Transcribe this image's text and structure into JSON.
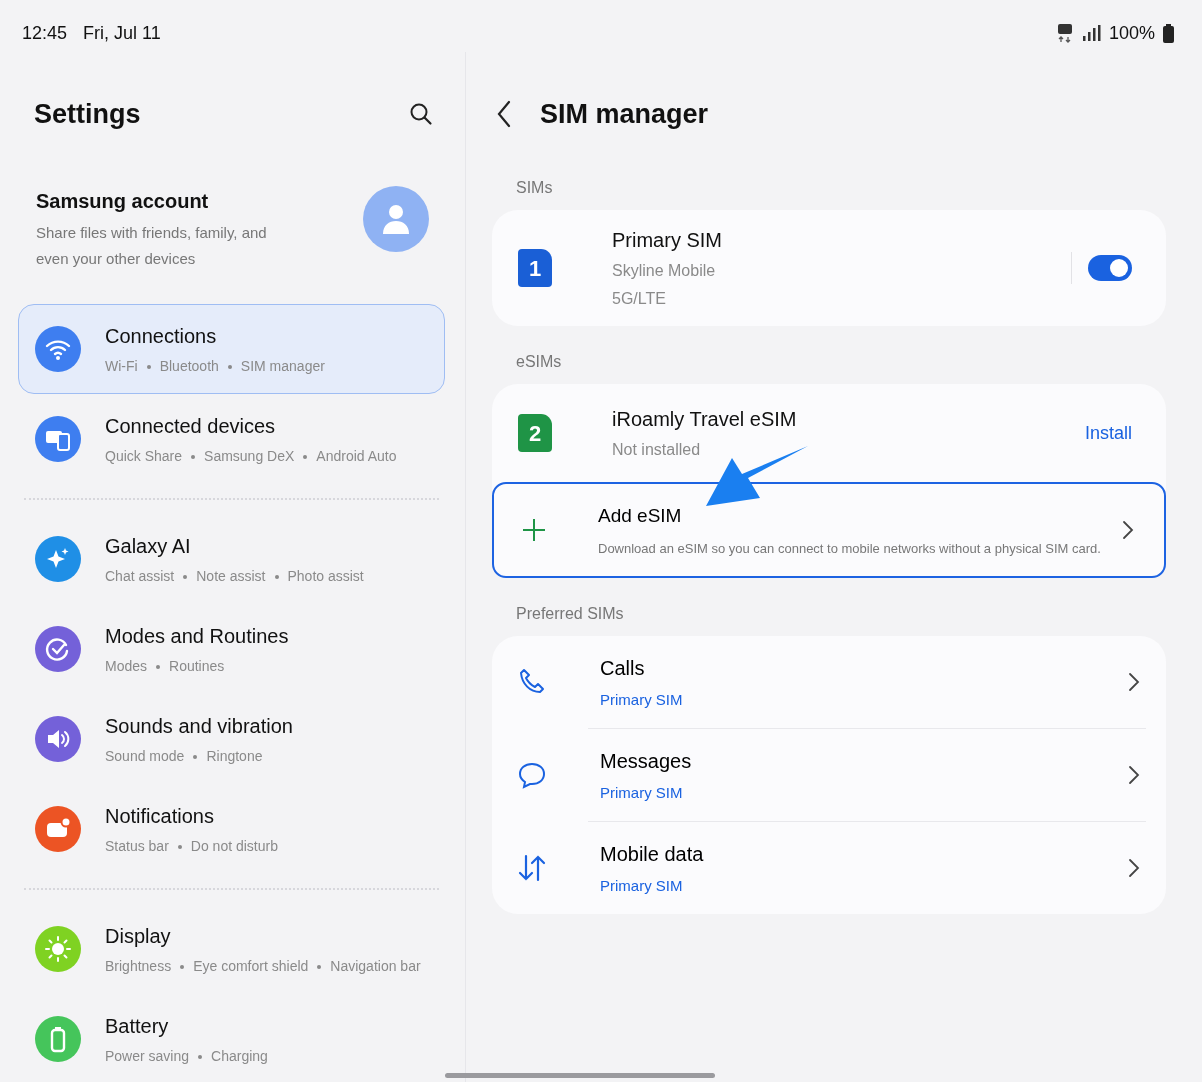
{
  "status_bar": {
    "time": "12:45",
    "date": "Fri, Jul 11",
    "battery": "100%"
  },
  "settings": {
    "title": "Settings",
    "account": {
      "name": "Samsung account",
      "description": "Share files with friends, family, and even your other devices"
    },
    "items": [
      {
        "title": "Connections",
        "subtitles": [
          "Wi-Fi",
          "Bluetooth",
          "SIM manager"
        ],
        "kind": "wifi",
        "color": "#3e7ef0",
        "selected": true,
        "divider_after": false
      },
      {
        "title": "Connected devices",
        "subtitles": [
          "Quick Share",
          "Samsung DeX",
          "Android Auto"
        ],
        "kind": "devices",
        "color": "#3e7ef0",
        "selected": false,
        "divider_after": true
      },
      {
        "title": "Galaxy AI",
        "subtitles": [
          "Chat assist",
          "Note assist",
          "Photo assist"
        ],
        "kind": "sparkle",
        "color": "#1f8fe6",
        "selected": false,
        "divider_after": false
      },
      {
        "title": "Modes and Routines",
        "subtitles": [
          "Modes",
          "Routines"
        ],
        "kind": "routine",
        "color": "#7461d9",
        "selected": false,
        "divider_after": false
      },
      {
        "title": "Sounds and vibration",
        "subtitles": [
          "Sound mode",
          "Ringtone"
        ],
        "kind": "sound",
        "color": "#7461d9",
        "selected": false,
        "divider_after": false
      },
      {
        "title": "Notifications",
        "subtitles": [
          "Status bar",
          "Do not disturb"
        ],
        "kind": "notification",
        "color": "#ec5424",
        "selected": false,
        "divider_after": true
      },
      {
        "title": "Display",
        "subtitles": [
          "Brightness",
          "Eye comfort shield",
          "Navigation bar"
        ],
        "kind": "display",
        "color": "#7fd222",
        "selected": false,
        "divider_after": false
      },
      {
        "title": "Battery",
        "subtitles": [
          "Power saving",
          "Charging"
        ],
        "kind": "battery",
        "color": "#45c55b",
        "selected": false,
        "divider_after": false
      }
    ]
  },
  "sim_manager": {
    "title": "SIM manager",
    "sims": {
      "header": "SIMs",
      "items": [
        {
          "badge": "1",
          "color": "#1a5fd6",
          "name": "Primary SIM",
          "lines": [
            "Skyline Mobile",
            "5G/LTE"
          ],
          "on": true
        }
      ]
    },
    "esims": {
      "header": "eSIMs",
      "items": [
        {
          "badge": "2",
          "color": "#1f9446",
          "name": "iRoamly Travel eSIM",
          "status": "Not installed",
          "action": "Install"
        }
      ],
      "add": {
        "title": "Add eSIM",
        "description": "Download an eSIM so you can connect to mobile networks without a physical SIM card.",
        "highlighted": true
      }
    },
    "preferred": {
      "header": "Preferred SIMs",
      "items": [
        {
          "kind": "calls",
          "title": "Calls",
          "value": "Primary SIM"
        },
        {
          "kind": "messages",
          "title": "Messages",
          "value": "Primary SIM"
        },
        {
          "kind": "data",
          "title": "Mobile data",
          "value": "Primary SIM"
        }
      ]
    }
  }
}
